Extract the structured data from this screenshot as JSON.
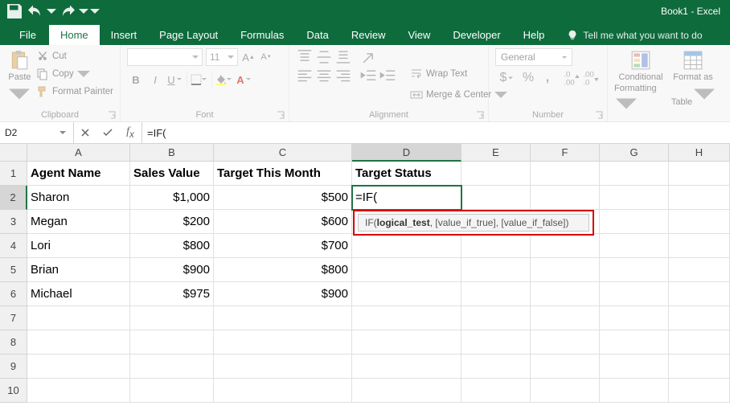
{
  "title": "Book1 - Excel",
  "tabs": {
    "file": "File",
    "home": "Home",
    "insert": "Insert",
    "pagelayout": "Page Layout",
    "formulas": "Formulas",
    "data": "Data",
    "review": "Review",
    "view": "View",
    "developer": "Developer",
    "help": "Help",
    "tellme": "Tell me what you want to do"
  },
  "ribbon": {
    "clipboard": {
      "paste": "Paste",
      "cut": "Cut",
      "copy": "Copy",
      "painter": "Format Painter",
      "label": "Clipboard"
    },
    "font": {
      "size": "11",
      "label": "Font"
    },
    "alignment": {
      "wrap": "Wrap Text",
      "merge": "Merge & Center",
      "label": "Alignment"
    },
    "number": {
      "format": "General",
      "label": "Number"
    },
    "styles": {
      "cond": "Conditional",
      "cond2": "Formatting",
      "fmt": "Format as",
      "fmt2": "Table"
    }
  },
  "namebox": "D2",
  "formula": "=IF(",
  "columns": [
    "A",
    "B",
    "C",
    "D",
    "E",
    "F",
    "G",
    "H"
  ],
  "rows": [
    "1",
    "2",
    "3",
    "4",
    "5",
    "6",
    "7",
    "8",
    "9",
    "10"
  ],
  "headers": {
    "A": "Agent Name",
    "B": "Sales Value",
    "C": "Target This Month",
    "D": "Target Status"
  },
  "data": {
    "r2": {
      "A": "Sharon",
      "B": "$1,000",
      "C": "$500",
      "D": "=IF("
    },
    "r3": {
      "A": "Megan",
      "B": "$200",
      "C": "$600"
    },
    "r4": {
      "A": "Lori",
      "B": "$800",
      "C": "$700"
    },
    "r5": {
      "A": "Brian",
      "B": "$900",
      "C": "$800"
    },
    "r6": {
      "A": "Michael",
      "B": "$975",
      "C": "$900"
    }
  },
  "tooltip": {
    "fn": "IF",
    "arg1": "logical_test",
    "arg2": ", [value_if_true], [value_if_false])"
  },
  "active_col_index": 3,
  "active_row_index": 1
}
